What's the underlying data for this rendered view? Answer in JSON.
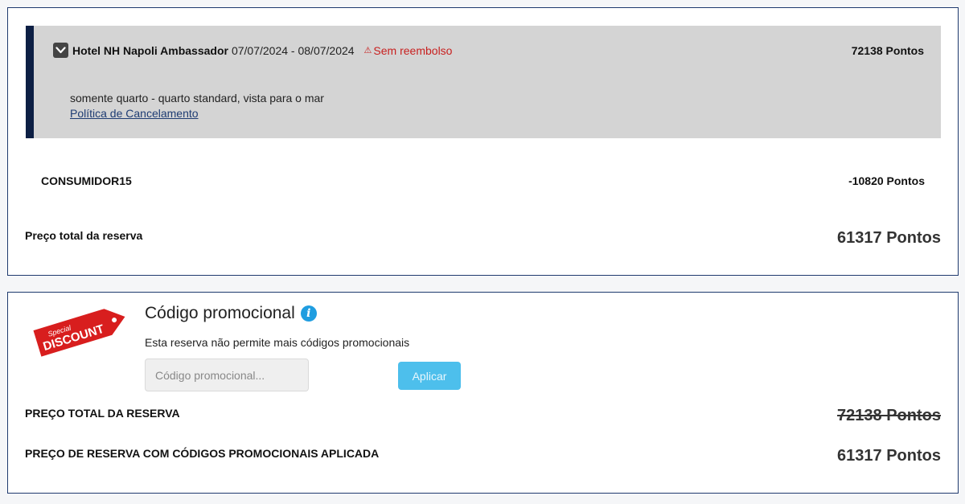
{
  "booking": {
    "hotel_name": "Hotel NH Napoli Ambassador",
    "dates": "07/07/2024 - 08/07/2024",
    "warning": "Sem reembolso",
    "warning_icon": "warning-triangle-icon",
    "price": "72138 Pontos",
    "room_description": "somente quarto - quarto standard, vista para o mar",
    "cancel_policy_link": "Política de Cancelamento",
    "coupon_code": "CONSUMIDOR15",
    "coupon_value": "-10820 Pontos",
    "total_label": "Preço total da reserva",
    "total_value": "61317 Pontos"
  },
  "promo": {
    "badge_line1": "Special",
    "badge_line2": "DISCOUNT",
    "title": "Código promocional",
    "info_icon_glyph": "i",
    "note": "Esta reserva não permite mais códigos promocionais",
    "input_placeholder": "Código promocional...",
    "apply_label": "Aplicar",
    "total_label": "PREÇO TOTAL DA RESERVA",
    "total_value": "72138 Pontos",
    "final_label": "PREÇO DE RESERVA COM CÓDIGOS PROMOCIONAIS APLICADA",
    "final_value": "61317 Pontos"
  },
  "colors": {
    "accent_navy": "#0d1f44",
    "warning_red": "#c8201f",
    "link_blue": "#1e3c73",
    "button_blue": "#4dbfec",
    "badge_red": "#d81e1e"
  }
}
